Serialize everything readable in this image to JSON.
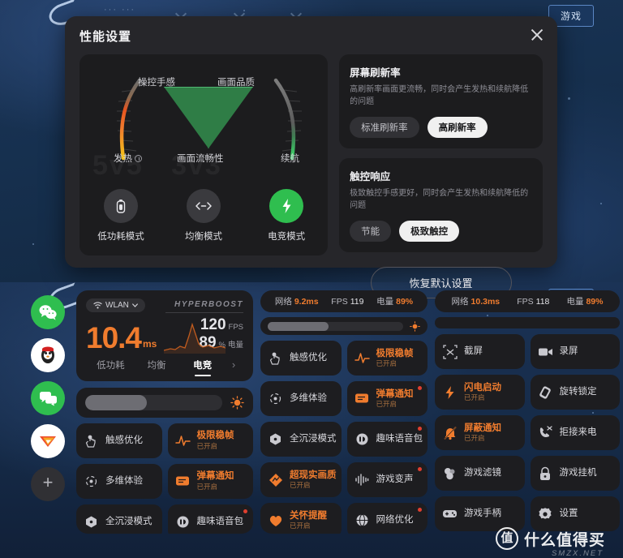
{
  "background": {
    "hud_top_left": "···  ···",
    "hud_button": "游戏",
    "ghost_left": "5v5",
    "ghost_right": "3v3"
  },
  "perf_dialog": {
    "title": "性能设置",
    "close_icon": "close-icon",
    "gauge": {
      "label_control": "操控手感",
      "label_quality": "画面品质",
      "label_heat": "发热",
      "label_smooth": "画面流畅性",
      "label_battery": "续航",
      "heat_color": "#f5a623",
      "battery_color": "#2fbe4f",
      "triangle_color": "#2f7d46"
    },
    "modes": [
      {
        "name": "低功耗模式",
        "icon": "battery-icon",
        "active": false
      },
      {
        "name": "均衡模式",
        "icon": "balance-arrows-icon",
        "active": false
      },
      {
        "name": "电竞模式",
        "icon": "lightning-bolt-icon",
        "active": true
      }
    ],
    "refresh": {
      "title": "屏幕刷新率",
      "desc": "高刷新率画面更流畅，同时会产生发热和续航降低的问题",
      "options": [
        "标准刷新率",
        "高刷新率"
      ],
      "selected": "高刷新率"
    },
    "touch": {
      "title": "触控响应",
      "desc": "极致触控手感更好，同时会产生发热和续航降低的问题",
      "options": [
        "节能",
        "极致触控"
      ],
      "selected": "极致触控"
    },
    "restore_label": "恢复默认设置"
  },
  "assistant": {
    "apps": [
      {
        "name": "wechat-icon",
        "glyph": "💬",
        "bg": "#2fbe4f"
      },
      {
        "name": "qq-icon",
        "glyph": "🐧",
        "bg": "#ffffff"
      },
      {
        "name": "messages-icon",
        "glyph": "💭",
        "bg": "#2fbe4f"
      },
      {
        "name": "game-center-icon",
        "glyph": "🎮",
        "bg": "#ffffff"
      }
    ],
    "add_label": "+",
    "status": {
      "wlan_label": "WLAN",
      "hyperboost": "HYPERBOOST",
      "ping_value": "10.4",
      "ping_unit": "ms",
      "fps_value": "120",
      "fps_unit": "FPS",
      "battery_value": "89",
      "battery_unit": "%",
      "battery_label": "电量"
    },
    "mode_tabs": [
      {
        "label": "低功耗",
        "active": false
      },
      {
        "label": "均衡",
        "active": false
      },
      {
        "label": "电竞",
        "active": true
      }
    ],
    "next_icon": "chevron-right-icon",
    "brightness": {
      "percent": 45,
      "icon": "sun-icon"
    },
    "tiles_main": [
      {
        "label": "触感优化",
        "sub": "",
        "icon": "touch-icon",
        "on": false,
        "badge": false
      },
      {
        "label": "极限稳帧",
        "sub": "已开启",
        "icon": "pulse-icon",
        "on": true,
        "badge": false
      },
      {
        "label": "多维体验",
        "sub": "",
        "icon": "orbit-icon",
        "on": false,
        "badge": false
      },
      {
        "label": "弹幕通知",
        "sub": "已开启",
        "icon": "danmaku-icon",
        "on": true,
        "badge": false
      },
      {
        "label": "全沉浸模式",
        "sub": "",
        "icon": "cube-icon",
        "on": false,
        "badge": false
      },
      {
        "label": "趣味语音包",
        "sub": "",
        "icon": "voice-pack-icon",
        "on": false,
        "badge": true
      }
    ],
    "mid_header": {
      "net_label": "网络",
      "net_value": "9.2ms",
      "fps_label": "FPS",
      "fps_value": "119",
      "batt_label": "电量",
      "batt_value": "89%"
    },
    "tiles_mid": [
      {
        "label": "触感优化",
        "sub": "",
        "icon": "touch-icon",
        "on": false,
        "badge": false
      },
      {
        "label": "极限稳帧",
        "sub": "已开启",
        "icon": "pulse-icon",
        "on": true,
        "badge": false
      },
      {
        "label": "多维体验",
        "sub": "",
        "icon": "orbit-icon",
        "on": false,
        "badge": false
      },
      {
        "label": "弹幕通知",
        "sub": "已开启",
        "icon": "danmaku-icon",
        "on": true,
        "badge": true
      },
      {
        "label": "全沉浸模式",
        "sub": "",
        "icon": "cube-icon",
        "on": false,
        "badge": false
      },
      {
        "label": "趣味语音包",
        "sub": "",
        "icon": "voice-pack-icon",
        "on": false,
        "badge": true
      },
      {
        "label": "超现实画质",
        "sub": "已开启",
        "icon": "hdr-icon",
        "on": true,
        "badge": false
      },
      {
        "label": "游戏变声",
        "sub": "",
        "icon": "voice-changer-icon",
        "on": false,
        "badge": true
      },
      {
        "label": "关怀提醒",
        "sub": "已开启",
        "icon": "heart-icon",
        "on": true,
        "badge": false
      },
      {
        "label": "网络优化",
        "sub": "",
        "icon": "globe-icon",
        "on": false,
        "badge": true
      }
    ],
    "right_header": {
      "net_label": "网络",
      "net_value": "10.3ms",
      "fps_label": "FPS",
      "fps_value": "118",
      "batt_label": "电量",
      "batt_value": "89%"
    },
    "tiles_right": [
      {
        "label": "截屏",
        "sub": "",
        "icon": "screenshot-icon",
        "on": false,
        "badge": false
      },
      {
        "label": "录屏",
        "sub": "",
        "icon": "record-icon",
        "on": false,
        "badge": false
      },
      {
        "label": "闪电启动",
        "sub": "已开启",
        "icon": "lightning-icon",
        "on": true,
        "badge": false
      },
      {
        "label": "旋转锁定",
        "sub": "",
        "icon": "rotate-lock-icon",
        "on": false,
        "badge": false
      },
      {
        "label": "屏蔽通知",
        "sub": "已开启",
        "icon": "bell-off-icon",
        "on": true,
        "badge": false
      },
      {
        "label": "拒接来电",
        "sub": "",
        "icon": "call-reject-icon",
        "on": false,
        "badge": false
      },
      {
        "label": "游戏滤镜",
        "sub": "",
        "icon": "filter-icon",
        "on": false,
        "badge": false
      },
      {
        "label": "游戏挂机",
        "sub": "",
        "icon": "lock-icon",
        "on": false,
        "badge": false
      },
      {
        "label": "游戏手柄",
        "sub": "",
        "icon": "gamepad-icon",
        "on": false,
        "badge": false
      },
      {
        "label": "设置",
        "sub": "",
        "icon": "gear-icon",
        "on": false,
        "badge": false
      }
    ]
  },
  "watermark": {
    "mark": "值",
    "text": "什么值得买",
    "sub": "SMZX.NET"
  }
}
